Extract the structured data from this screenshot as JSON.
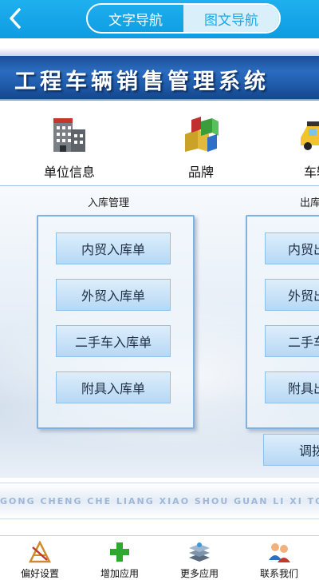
{
  "nav": {
    "back_icon": "chevron-left-icon",
    "tabs": [
      {
        "label": "文字导航",
        "active": false
      },
      {
        "label": "图文导航",
        "active": true
      }
    ]
  },
  "banner": {
    "title": "工程车辆销售管理系统"
  },
  "modules": [
    {
      "label": "单位信息",
      "icon": "building-icon"
    },
    {
      "label": "品牌",
      "icon": "blocks-icon"
    },
    {
      "label": "车辆",
      "icon": "taxi-icon"
    }
  ],
  "groups": [
    {
      "title": "入库管理",
      "buttons": [
        "内贸入库单",
        "外贸入库单",
        "二手车入库单",
        "附具入库单"
      ]
    },
    {
      "title": "出库",
      "buttons": [
        "内贸出",
        "外贸出",
        "二手车",
        "附具出"
      ],
      "extra_button": "调拨"
    }
  ],
  "strip": {
    "text": "GONG CHENG CHE LIANG XIAO SHOU GUAN LI XI TONG"
  },
  "tabbar": [
    {
      "label": "偏好设置",
      "icon": "preferences-icon"
    },
    {
      "label": "增加应用",
      "icon": "plus-icon"
    },
    {
      "label": "更多应用",
      "icon": "layers-icon"
    },
    {
      "label": "联系我们",
      "icon": "contacts-icon"
    }
  ],
  "colors": {
    "topbar": "#1aa6ea",
    "banner": "#1e5aa8",
    "button": "#c6e2f8"
  }
}
